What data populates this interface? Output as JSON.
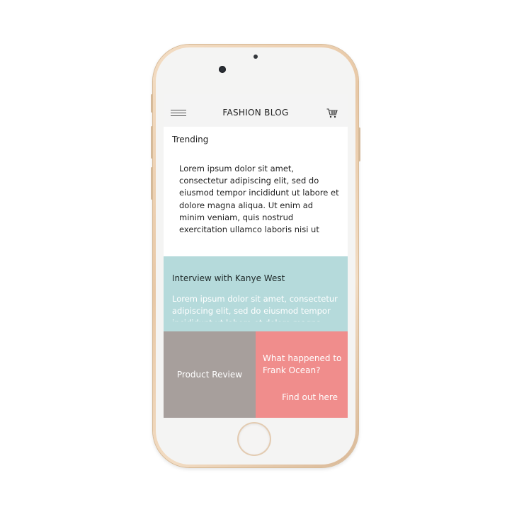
{
  "app": {
    "title": "FASHION BLOG",
    "menu_icon": "hamburger-menu-icon",
    "cart_icon": "shopping-cart-icon"
  },
  "trending": {
    "heading": "Trending",
    "body": "Lorem ipsum dolor sit amet, consectetur adipiscing elit, sed do eiusmod tempor incididunt ut labore et dolore magna aliqua. Ut enim ad minim veniam, quis nostrud exercitation ullamco laboris nisi ut"
  },
  "interview": {
    "heading": "Interview with Kanye West",
    "body": "Lorem ipsum dolor sit amet, consectetur adipiscing elit, sed do eiusmod tempor incididunt ut labore et dolore magna aliqua."
  },
  "tiles": {
    "review_label": "Product Review",
    "frank_title": "What happened to Frank Ocean?",
    "frank_link": "Find out here"
  },
  "colors": {
    "interview_bg": "#b5dadb",
    "review_bg": "#a79f9c",
    "frank_bg": "#f08d8c",
    "appbar_bg": "#f4f4f4",
    "phone_frame": "#e8c8a6"
  }
}
